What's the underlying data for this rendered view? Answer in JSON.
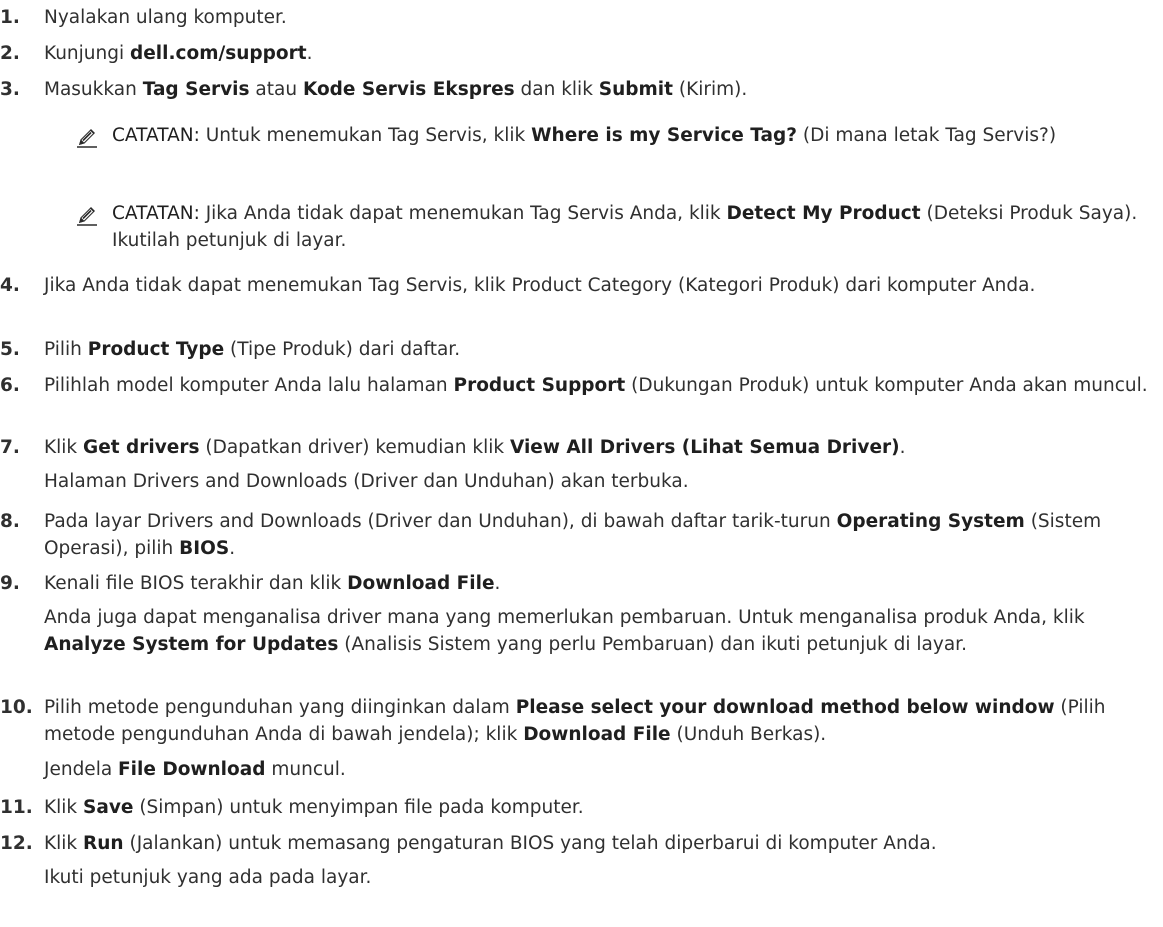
{
  "steps": [
    {
      "num": "1.",
      "parts": [
        {
          "t": "Nyalakan ulang komputer.",
          "b": false
        }
      ]
    },
    {
      "num": "2.",
      "parts": [
        {
          "t": "Kunjungi ",
          "b": false
        },
        {
          "t": "dell.com/support",
          "b": true
        },
        {
          "t": ".",
          "b": false
        }
      ]
    },
    {
      "num": "3.",
      "parts": [
        {
          "t": "Masukkan ",
          "b": false
        },
        {
          "t": "Tag Servis",
          "b": true
        },
        {
          "t": " atau ",
          "b": false
        },
        {
          "t": "Kode Servis Ekspres",
          "b": true
        },
        {
          "t": " dan klik ",
          "b": false
        },
        {
          "t": "Submit",
          "b": true
        },
        {
          "t": " (Kirim).",
          "b": false
        }
      ]
    },
    {
      "num": "4.",
      "parts": [
        {
          "t": "Jika Anda tidak dapat menemukan Tag Servis, klik Product Category (Kategori Produk) dari komputer Anda.",
          "b": false
        }
      ]
    },
    {
      "num": "5.",
      "parts": [
        {
          "t": "Pilih ",
          "b": false
        },
        {
          "t": "Product Type",
          "b": true
        },
        {
          "t": " (Tipe Produk) dari daftar.",
          "b": false
        }
      ]
    },
    {
      "num": "6.",
      "parts": [
        {
          "t": "Pilihlah model komputer Anda lalu halaman ",
          "b": false
        },
        {
          "t": "Product Support",
          "b": true
        },
        {
          "t": " (Dukungan Produk) untuk komputer Anda akan muncul.",
          "b": false
        }
      ]
    },
    {
      "num": "7.",
      "parts": [
        {
          "t": "Klik ",
          "b": false
        },
        {
          "t": "Get drivers",
          "b": true
        },
        {
          "t": " (Dapatkan driver) kemudian klik ",
          "b": false
        },
        {
          "t": "View All Drivers (Lihat Semua Driver)",
          "b": true
        },
        {
          "t": ".",
          "b": false
        }
      ]
    },
    {
      "num": "8.",
      "parts": [
        {
          "t": "Pada layar Drivers and Downloads (Driver dan Unduhan), di bawah daftar tarik-turun ",
          "b": false
        },
        {
          "t": "Operating System",
          "b": true
        },
        {
          "t": " (Sistem Operasi), pilih ",
          "b": false
        },
        {
          "t": "BIOS",
          "b": true
        },
        {
          "t": ".",
          "b": false
        }
      ]
    },
    {
      "num": "9.",
      "parts": [
        {
          "t": "Kenali file BIOS terakhir dan klik ",
          "b": false
        },
        {
          "t": "Download File",
          "b": true
        },
        {
          "t": ".",
          "b": false
        }
      ]
    },
    {
      "num": "10.",
      "parts": [
        {
          "t": "Pilih metode pengunduhan yang diinginkan dalam ",
          "b": false
        },
        {
          "t": "Please select your download method below window",
          "b": true
        },
        {
          "t": " (Pilih metode pengunduhan Anda di bawah jendela); klik ",
          "b": false
        },
        {
          "t": "Download File",
          "b": true
        },
        {
          "t": " (Unduh Berkas).",
          "b": false
        }
      ]
    },
    {
      "num": "11.",
      "parts": [
        {
          "t": "Klik ",
          "b": false
        },
        {
          "t": "Save",
          "b": true
        },
        {
          "t": " (Simpan) untuk menyimpan file pada komputer.",
          "b": false
        }
      ]
    },
    {
      "num": "12.",
      "parts": [
        {
          "t": "Klik ",
          "b": false
        },
        {
          "t": "Run",
          "b": true
        },
        {
          "t": " (Jalankan) untuk memasang pengaturan BIOS yang telah diperbarui di komputer Anda.",
          "b": false
        }
      ]
    }
  ],
  "notes": [
    {
      "label": "CATATAN:",
      "parts": [
        {
          "t": " Untuk menemukan Tag Servis, klik ",
          "b": false
        },
        {
          "t": "Where is my Service Tag?",
          "b": true
        },
        {
          "t": " (Di mana letak Tag Servis?)",
          "b": false
        }
      ]
    },
    {
      "label": "CATATAN:",
      "parts": [
        {
          "t": " Jika Anda tidak dapat menemukan Tag Servis Anda, klik ",
          "b": false
        },
        {
          "t": "Detect My Product",
          "b": true
        },
        {
          "t": " (Deteksi Produk Saya). Ikutilah petunjuk di layar.",
          "b": false
        }
      ]
    }
  ],
  "subs": {
    "s7": [
      {
        "t": "Halaman Drivers and Downloads (Driver dan Unduhan) akan terbuka.",
        "b": false
      }
    ],
    "s9": [
      {
        "t": "Anda juga dapat menganalisa driver mana yang memerlukan pembaruan. Untuk menganalisa produk Anda, klik ",
        "b": false
      },
      {
        "t": "Analyze System for Updates",
        "b": true
      },
      {
        "t": " (Analisis Sistem yang perlu Pembaruan) dan ikuti petunjuk di layar.",
        "b": false
      }
    ],
    "s10": [
      {
        "t": "Jendela ",
        "b": false
      },
      {
        "t": "File Download",
        "b": true
      },
      {
        "t": " muncul.",
        "b": false
      }
    ],
    "s12": [
      {
        "t": "Ikuti petunjuk yang ada pada layar.",
        "b": false
      }
    ]
  }
}
